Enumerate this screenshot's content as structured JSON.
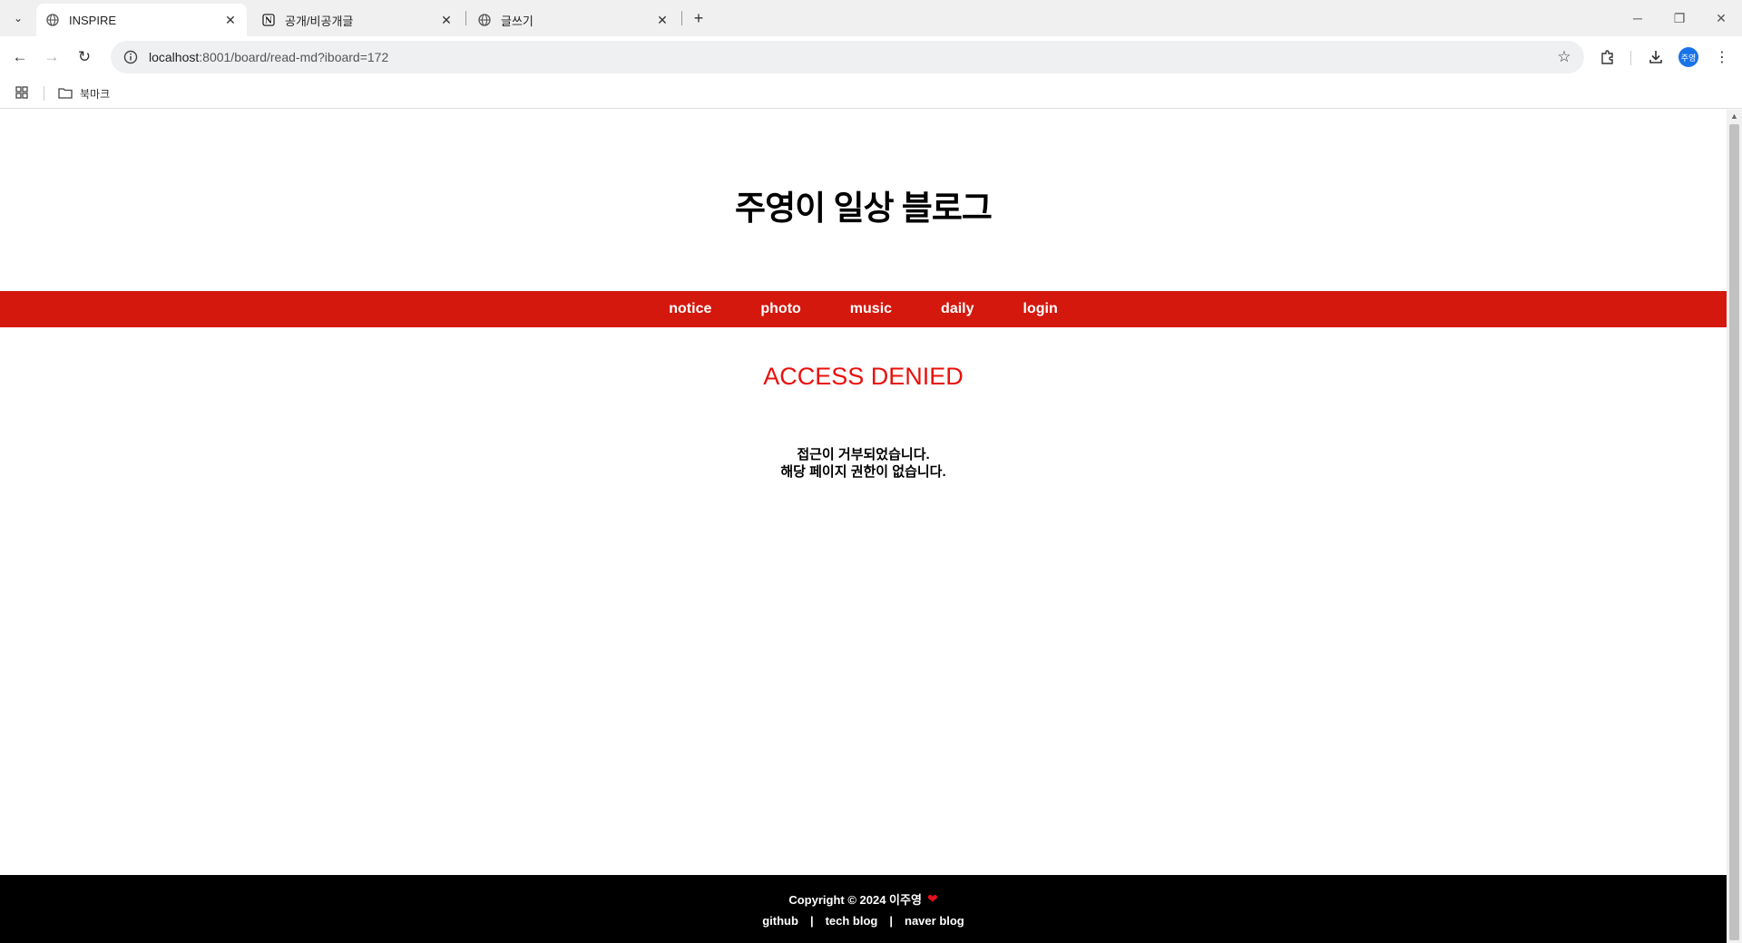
{
  "browser": {
    "tabs": [
      {
        "title": "INSPIRE",
        "favicon": "globe-icon"
      },
      {
        "title": "공개/비공개글",
        "favicon": "notion-icon"
      },
      {
        "title": "글쓰기",
        "favicon": "globe-icon"
      }
    ],
    "url_host": "localhost",
    "url_rest": ":8001/board/read-md?iboard=172",
    "profile_initials": "주영",
    "bookmarks_folder": "북마크"
  },
  "site": {
    "title": "주영이 일상 블로그",
    "accent_color": "#d4180e",
    "menu": [
      "notice",
      "photo",
      "music",
      "daily",
      "login"
    ]
  },
  "content": {
    "heading": "ACCESS DENIED",
    "line1": "접근이 거부되었습니다.",
    "line2": "해당 페이지 권한이 없습니다."
  },
  "footer": {
    "copyright": "Copyright © 2024 이주영",
    "links": [
      "github",
      "tech blog",
      "naver blog"
    ],
    "separator": "|"
  }
}
